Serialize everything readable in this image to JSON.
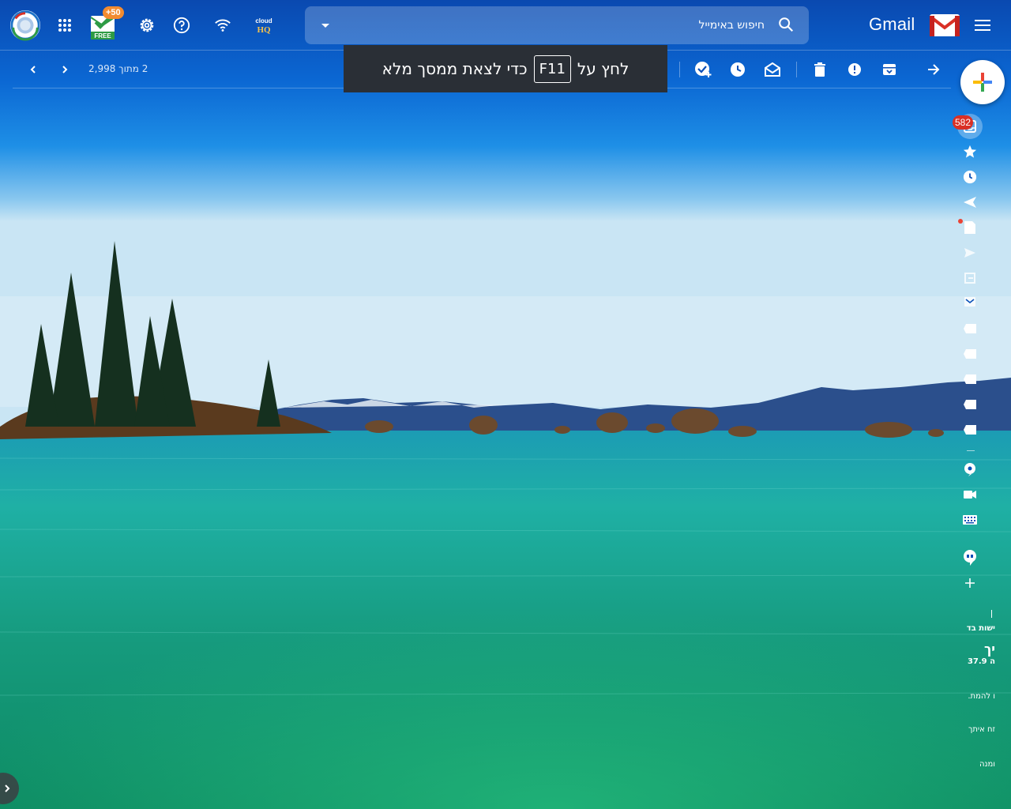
{
  "app": {
    "logo_text": "Gmail"
  },
  "search": {
    "placeholder": "חיפוש באימייל"
  },
  "topbar_left": {
    "checker_badge": "+50",
    "checker_label": "FREE",
    "cloudhq_label": "cloud HQ"
  },
  "toolbar": {
    "paging": "2 מתוך 2,998"
  },
  "toast": {
    "prefix": "לחץ על",
    "key": "F11",
    "suffix": "כדי לצאת ממסך מלא"
  },
  "rail": {
    "inbox_count": "582",
    "meet_header": "פגישות",
    "meet_texts": [
      "ישות בד",
      "יך",
      "ה 37.9",
      "ו להמת.",
      "זח איתך",
      "ומנה"
    ]
  },
  "colors": {
    "toast_bg": "#2a2f36",
    "badge_red": "#d93025",
    "checker_orange": "#f28b30",
    "sky_top": "#0a4fb8",
    "water": "#1ca89a"
  },
  "icons": {
    "topbar": [
      "menu-icon",
      "gmail-logo",
      "search-icon",
      "caret-down-icon",
      "avatar",
      "apps-icon",
      "checker-icon",
      "settings-icon",
      "help-icon",
      "wifi-icon",
      "cloudhq-icon"
    ],
    "toolbar": [
      "back-arrow-icon",
      "archive-icon",
      "report-spam-icon",
      "delete-icon",
      "mark-unread-icon",
      "snooze-icon",
      "add-task-icon",
      "move-to-icon",
      "prev-icon",
      "next-icon"
    ],
    "rail": [
      "compose-plus-icon",
      "inbox-icon",
      "star-icon",
      "clock-icon",
      "important-icon",
      "draft-icon",
      "sent-icon",
      "scheduled-icon",
      "all-mail-icon",
      "label-icon",
      "chat-icon",
      "video-icon",
      "keyboard-icon",
      "hangouts-icon",
      "plus-icon",
      "expand-icon"
    ]
  }
}
